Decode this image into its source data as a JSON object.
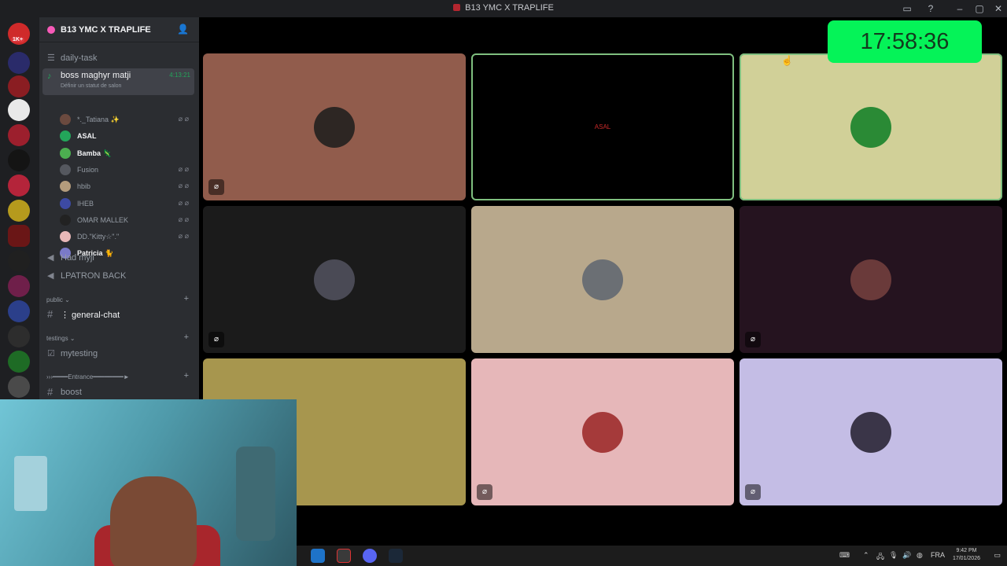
{
  "window": {
    "title": "B13 YMC X TRAPLIFE"
  },
  "server": {
    "name": "B13 YMC X TRAPLIFE",
    "rail_badge": "1K+"
  },
  "channels": {
    "daily_task": "daily-task",
    "voice_active": {
      "name": "boss maghyr matji",
      "status": "Définir un statut de salon",
      "timer": "4:13:21"
    },
    "voice_users": [
      {
        "name": "*._Tatiana ✨",
        "color": "#6b4a3f",
        "bold": false
      },
      {
        "name": "ASAL",
        "color": "#23a55a",
        "bold": true
      },
      {
        "name": "Bamba 🦎",
        "color": "#4caf50",
        "bold": true
      },
      {
        "name": "Fusion",
        "color": "#55585f",
        "bold": false
      },
      {
        "name": "hbib",
        "color": "#b49c7c",
        "bold": false
      },
      {
        "name": "IHEB",
        "color": "#3d4aa3",
        "bold": false
      },
      {
        "name": "OMAR MALLEK",
        "color": "#222222",
        "bold": false
      },
      {
        "name": "DD.\"Kitty☆\".\"",
        "color": "#e8b8b8",
        "bold": false
      },
      {
        "name": "Patricia 🐈",
        "color": "#7a7ac8",
        "bold": true
      }
    ],
    "had_myji": "Had myji",
    "lpatron": "LPATRON BACK",
    "cat_public": "public ⌄",
    "general_chat": "⋮ general-chat",
    "cat_testings": "testings ⌄",
    "mytesting": "mytesting",
    "cat_entrance": "›››━━━━Entrance━━━━━━━━►",
    "boost": "boost"
  },
  "clock": "17:58:36",
  "tiles": [
    {
      "bg": "#915c4c",
      "avatar": "#2d2623",
      "muted": true,
      "speaking": false
    },
    {
      "bg": "#000000",
      "avatar": "#000000",
      "muted": false,
      "speaking": true,
      "text": "ASAL"
    },
    {
      "bg": "#d1d098",
      "avatar": "#2a8a35",
      "muted": false,
      "speaking": true
    },
    {
      "bg": "#1b1b1b",
      "avatar": "#4a4a55",
      "muted": true,
      "speaking": false
    },
    {
      "bg": "#b8a88c",
      "avatar": "#6b6f74",
      "muted": false,
      "speaking": false
    },
    {
      "bg": "#25131f",
      "avatar": "#6a3a3a",
      "muted": true,
      "speaking": false
    },
    {
      "bg": "#a7964e",
      "avatar": "#a7964e",
      "muted": false,
      "speaking": false
    },
    {
      "bg": "#e6b7b9",
      "avatar": "#a53a3a",
      "muted": true,
      "speaking": false
    },
    {
      "bg": "#c4bde5",
      "avatar": "#3a3548",
      "muted": true,
      "speaking": false
    }
  ],
  "taskbar": {
    "lang": "FRA",
    "time": "9:42 PM",
    "date": "17/01/2026"
  },
  "icons": {
    "mute": "⌀",
    "channel_hash": "#",
    "voice": "🔊"
  }
}
